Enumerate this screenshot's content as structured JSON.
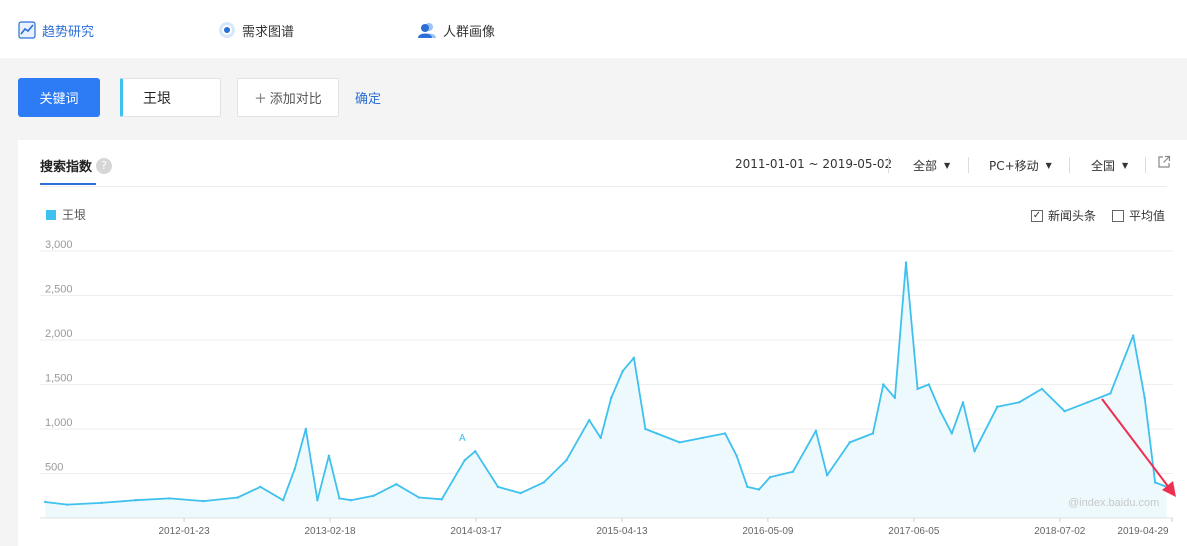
{
  "nav": {
    "items": [
      {
        "label": "趋势研究",
        "icon": "trend-chart-icon",
        "active": true
      },
      {
        "label": "需求图谱",
        "icon": "target-circle-icon",
        "active": false
      },
      {
        "label": "人群画像",
        "icon": "people-icon",
        "active": false
      }
    ]
  },
  "search": {
    "keyword_button": "关键词",
    "keyword_value": "王垠",
    "add_compare": "添加对比",
    "add_icon": "+",
    "confirm": "确定"
  },
  "panel": {
    "title": "搜索指数",
    "help_icon": "?",
    "date_range": "2011-01-01 ~ 2019-05-02",
    "filter_channel": "全部",
    "filter_device": "PC+移动",
    "filter_region": "全国",
    "caret": "▼",
    "export_icon": "external-link-icon"
  },
  "legend": {
    "label": "王垠",
    "color": "#3ec1ee"
  },
  "options": {
    "news_label": "新闻头条",
    "news_checked": true,
    "avg_label": "平均值",
    "avg_checked": false
  },
  "watermark": "@index.baidu.com",
  "annotation_marker": "A",
  "colors": {
    "accent": "#2d7cf6",
    "series": "#3ec1ee",
    "arrow": "#ee2f52"
  },
  "chart_data": {
    "type": "area",
    "series_name": "王垠",
    "ylim": [
      0,
      3000
    ],
    "y_ticks": [
      "3,000",
      "2,500",
      "2,000",
      "1,500",
      "1,000",
      "500"
    ],
    "y_tick_values": [
      3000,
      2500,
      2000,
      1500,
      1000,
      500
    ],
    "x_tick_labels": [
      "2012-01-23",
      "2013-02-18",
      "2014-03-17",
      "2015-04-13",
      "2016-05-09",
      "2017-06-05",
      "2018-07-02",
      "2019-04-29"
    ],
    "x_range": [
      "2011-01-01",
      "2019-05-02"
    ],
    "x": [
      "2011-01",
      "2011-03",
      "2011-06",
      "2011-09",
      "2011-12",
      "2012-03",
      "2012-06",
      "2012-08",
      "2012-10",
      "2012-11",
      "2012-12",
      "2013-01",
      "2013-02",
      "2013-03",
      "2013-04",
      "2013-06",
      "2013-08",
      "2013-10",
      "2013-12",
      "2014-02",
      "2014-03",
      "2014-05",
      "2014-07",
      "2014-09",
      "2014-11",
      "2015-01",
      "2015-02",
      "2015-03",
      "2015-04",
      "2015-05",
      "2015-06",
      "2015-07",
      "2015-09",
      "2015-11",
      "2016-01",
      "2016-02",
      "2016-03",
      "2016-04",
      "2016-05",
      "2016-07",
      "2016-09",
      "2016-10",
      "2016-12",
      "2017-02",
      "2017-03",
      "2017-04",
      "2017-05",
      "2017-06",
      "2017-07",
      "2017-08",
      "2017-09",
      "2017-10",
      "2017-11",
      "2018-01",
      "2018-03",
      "2018-05",
      "2018-07",
      "2018-09",
      "2018-11",
      "2019-01",
      "2019-02",
      "2019-03",
      "2019-04"
    ],
    "y": [
      180,
      150,
      170,
      200,
      220,
      190,
      230,
      350,
      200,
      550,
      1000,
      200,
      700,
      220,
      200,
      250,
      380,
      230,
      210,
      650,
      750,
      350,
      280,
      400,
      650,
      1100,
      900,
      1350,
      1650,
      1800,
      1000,
      950,
      850,
      900,
      950,
      700,
      350,
      320,
      460,
      520,
      980,
      480,
      850,
      950,
      1500,
      1350,
      2870,
      1450,
      1500,
      1200,
      950,
      1300,
      750,
      1250,
      1300,
      1450,
      1200,
      1300,
      1400,
      2050,
      1350,
      400,
      350
    ]
  }
}
